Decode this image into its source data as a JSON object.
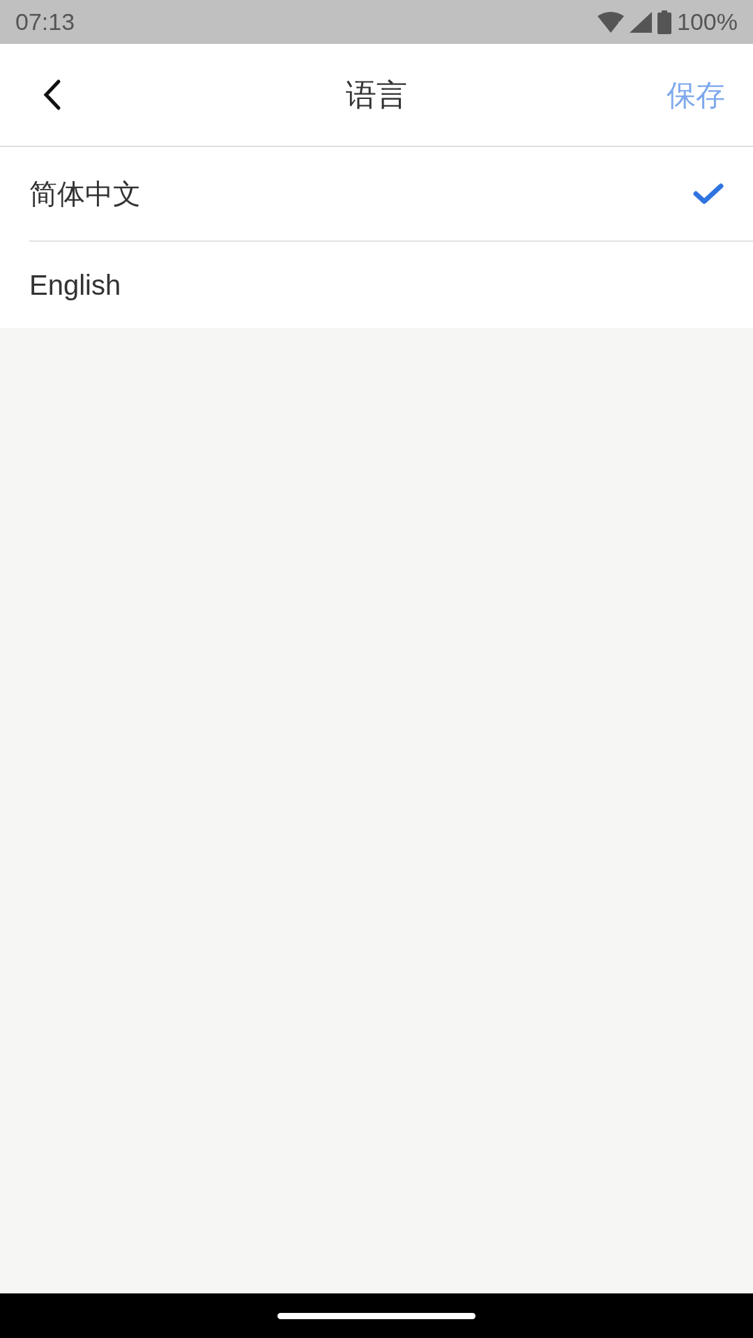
{
  "status_bar": {
    "time": "07:13",
    "battery": "100%"
  },
  "header": {
    "title": "语言",
    "save": "保存"
  },
  "languages": [
    {
      "label": "简体中文",
      "selected": true
    },
    {
      "label": "English",
      "selected": false
    }
  ]
}
